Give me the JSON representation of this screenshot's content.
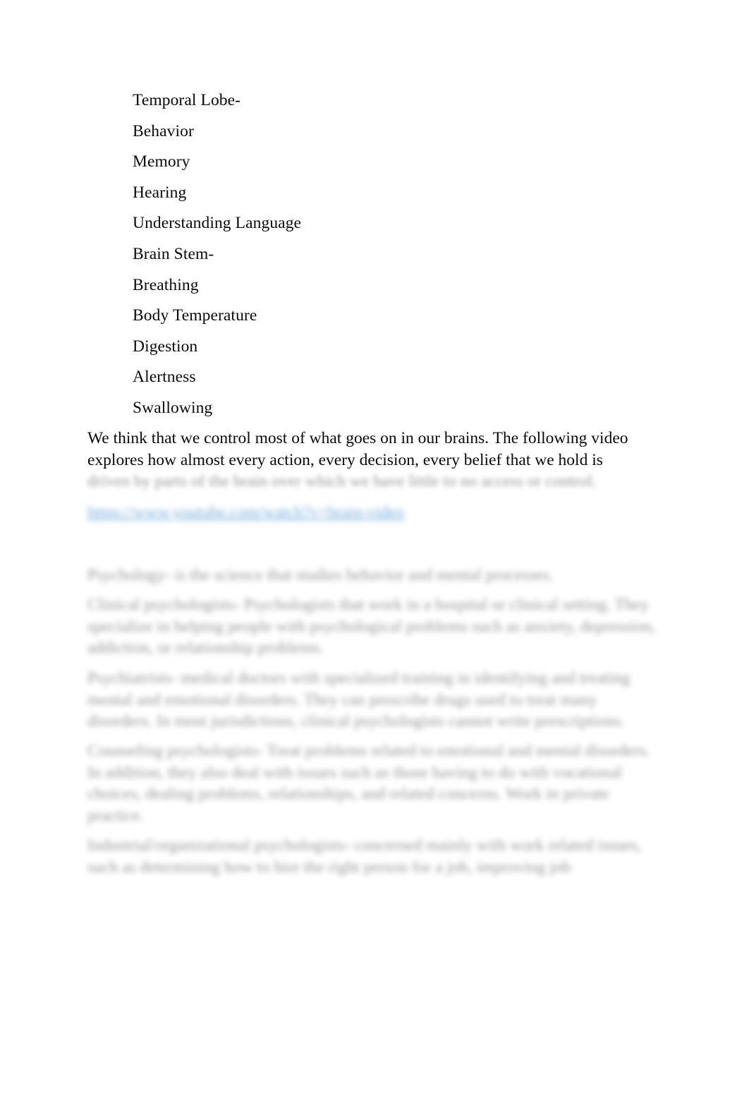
{
  "document": {
    "type": "word-processor-document",
    "background_color": "#ffffff",
    "text_color": "#000000",
    "link_color": "#5a9bd5"
  },
  "brain_functions_list": [
    {
      "label": "Temporal Lobe-",
      "is_heading": true
    },
    {
      "label": "Behavior",
      "is_heading": false
    },
    {
      "label": "Memory",
      "is_heading": false
    },
    {
      "label": "Hearing",
      "is_heading": false
    },
    {
      "label": "Understanding Language",
      "is_heading": false
    },
    {
      "label": "Brain Stem-",
      "is_heading": true
    },
    {
      "label": "Breathing",
      "is_heading": false
    },
    {
      "label": "Body Temperature",
      "is_heading": false
    },
    {
      "label": "Digestion",
      "is_heading": false
    },
    {
      "label": "Alertness",
      "is_heading": false
    },
    {
      "label": "Swallowing",
      "is_heading": false
    }
  ],
  "paragraph_control": {
    "line1": "We think that we control most of what goes on in our brains. The following video",
    "line2": "explores how almost every action, every decision, every belief that we hold is",
    "line3_blurred": "driven by parts of the brain over which we have little to no access or control."
  },
  "video_link": {
    "label_blurred": "https://www.youtube.com/watch?v=brain-video",
    "color": "#5a9bd5"
  },
  "blurred_paragraphs": {
    "psychology": "Psychology- is the science that studies behavior and mental processes.",
    "clinical": "Clinical psychologists- Psychologists that work in a hospital or clinical setting. They specialize in helping people with psychological problems such as anxiety, depression, addiction, or relationship problems.",
    "psychiatrist": "Psychiatrists- medical doctors with specialized training in identifying and treating mental and emotional disorders. They can prescribe drugs used to treat many disorders. In most jurisdictions, clinical psychologists cannot write prescriptions.",
    "counseling": "Counseling psychologists- Treat problems related to emotional and mental disorders. In addition, they also deal with issues such as those having to do with vocational choices, dealing problems, relationships, and related concerns. Work in private practice.",
    "industrial": "Industrial/organizational psychologists- concerned mainly with work related issues, such as determining how to hire the right person for a job, improving job"
  }
}
